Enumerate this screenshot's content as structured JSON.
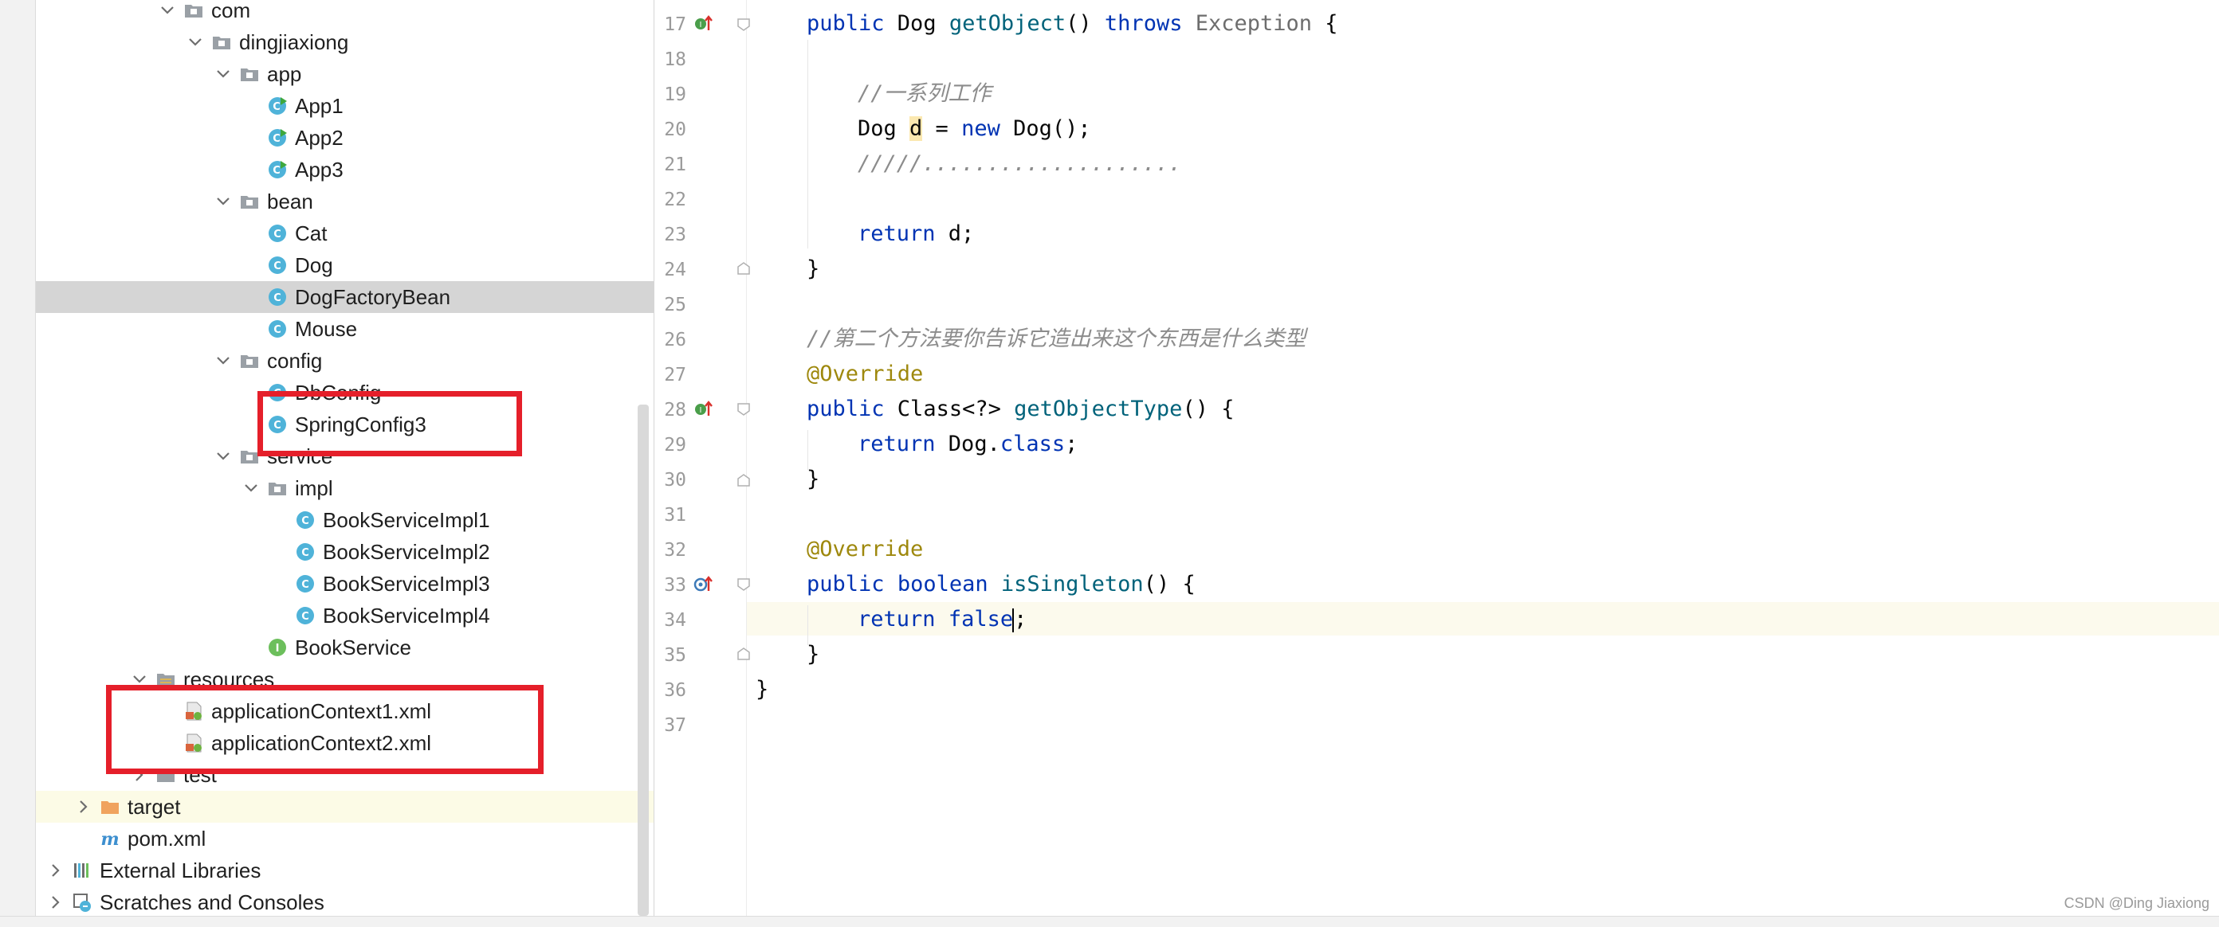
{
  "tree": {
    "items": [
      {
        "label": "com",
        "icon": "package-folder"
      },
      {
        "label": "dingjiaxiong",
        "icon": "package-folder"
      },
      {
        "label": "app",
        "icon": "package-folder"
      },
      {
        "label": "App1",
        "icon": "runnable-class"
      },
      {
        "label": "App2",
        "icon": "runnable-class"
      },
      {
        "label": "App3",
        "icon": "runnable-class"
      },
      {
        "label": "bean",
        "icon": "package-folder"
      },
      {
        "label": "Cat",
        "icon": "class"
      },
      {
        "label": "Dog",
        "icon": "class"
      },
      {
        "label": "DogFactoryBean",
        "icon": "class"
      },
      {
        "label": "Mouse",
        "icon": "class"
      },
      {
        "label": "config",
        "icon": "package-folder"
      },
      {
        "label": "DbConfig",
        "icon": "class"
      },
      {
        "label": "SpringConfig3",
        "icon": "class"
      },
      {
        "label": "service",
        "icon": "package-folder"
      },
      {
        "label": "impl",
        "icon": "package-folder"
      },
      {
        "label": "BookServiceImpl1",
        "icon": "class"
      },
      {
        "label": "BookServiceImpl2",
        "icon": "class"
      },
      {
        "label": "BookServiceImpl3",
        "icon": "class"
      },
      {
        "label": "BookServiceImpl4",
        "icon": "class"
      },
      {
        "label": "BookService",
        "icon": "interface"
      },
      {
        "label": "resources",
        "icon": "resources-folder"
      },
      {
        "label": "applicationContext1.xml",
        "icon": "spring-xml-file"
      },
      {
        "label": "applicationContext2.xml",
        "icon": "spring-xml-file"
      },
      {
        "label": "test",
        "icon": "folder"
      },
      {
        "label": "target",
        "icon": "excluded-folder"
      },
      {
        "label": "pom.xml",
        "icon": "maven-file"
      },
      {
        "label": "External Libraries",
        "icon": "libraries"
      },
      {
        "label": "Scratches and Consoles",
        "icon": "scratches"
      }
    ]
  },
  "editor": {
    "line_numbers": [
      "17",
      "18",
      "19",
      "20",
      "21",
      "22",
      "23",
      "24",
      "25",
      "26",
      "27",
      "28",
      "29",
      "30",
      "31",
      "32",
      "33",
      "34",
      "35",
      "36",
      "37"
    ],
    "current_line": "34",
    "code": {
      "l17": {
        "a": "public",
        "b": " Dog ",
        "c": "getObject",
        "d": "() ",
        "e": "throws",
        "f": " ",
        "g": "Exception",
        "h": " {"
      },
      "l19": {
        "a": "//一系列工作"
      },
      "l20": {
        "a": "Dog ",
        "b": "d",
        "c": " = ",
        "d": "new",
        "e": " Dog();"
      },
      "l21": {
        "a": "/////...................."
      },
      "l23": {
        "a": "return",
        "b": " d;"
      },
      "l24": {
        "a": "}"
      },
      "l26": {
        "a": "//第二个方法要你告诉它造出来这个东西是什么类型"
      },
      "l27": {
        "a": "@Override"
      },
      "l28": {
        "a": "public",
        "b": " Class<?> ",
        "c": "getObjectType",
        "d": "() {"
      },
      "l29": {
        "a": "return",
        "b": " Dog.",
        "c": "class",
        "d": ";"
      },
      "l30": {
        "a": "}"
      },
      "l32": {
        "a": "@Override"
      },
      "l33": {
        "a": "public",
        "b": " ",
        "c": "boolean",
        "d": " ",
        "e": "isSingleton",
        "f": "() {"
      },
      "l34": {
        "a": "return",
        "b": " ",
        "c": "false",
        "d": ";"
      },
      "l35": {
        "a": "}"
      },
      "l36": {
        "a": "}"
      }
    }
  },
  "watermark": "CSDN @Ding Jiaxiong",
  "colors": {
    "keyword": "#0033b3",
    "method": "#00627a",
    "comment": "#8c8c8c",
    "annotation": "#9e880d",
    "red_box": "#e51f2a"
  }
}
